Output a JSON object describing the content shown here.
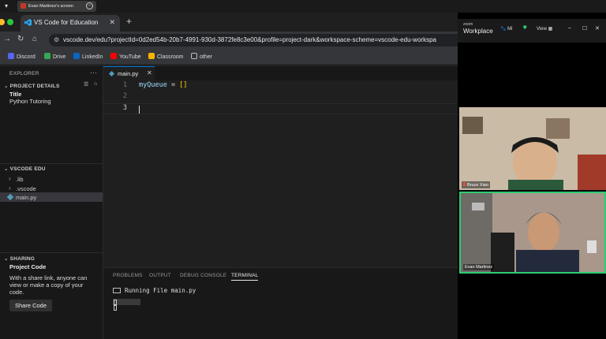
{
  "share_bar": {
    "tab_title": "Evan Martinez's screen"
  },
  "browser": {
    "tab_title": "VS Code for Education",
    "new_tab": "+",
    "url": "vscode.dev/edu?projectId=0d2ed54b-20b7-4991-930d-3872fe8c3e00&profile=project-dark&workspace-scheme=vscode-edu-workspa",
    "bookmarks": [
      {
        "label": "Discord",
        "color": "#5865f2"
      },
      {
        "label": "Drive",
        "color": "#34a853"
      },
      {
        "label": "LinkedIn",
        "color": "#0a66c2"
      },
      {
        "label": "YouTube",
        "color": "#ff0000"
      },
      {
        "label": "Classroom",
        "color": "#f4b400"
      },
      {
        "label": "other",
        "color": "#888888"
      }
    ]
  },
  "explorer": {
    "header": "EXPLORER",
    "project_details": {
      "heading": "PROJECT DETAILS",
      "title_label": "Title",
      "title_value": "Python Tutoring"
    },
    "workspace": {
      "heading": "VSCODE EDU",
      "items": [
        {
          "label": ".lib",
          "type": "folder"
        },
        {
          "label": ".vscode",
          "type": "folder"
        },
        {
          "label": "main.py",
          "type": "file"
        }
      ]
    },
    "sharing": {
      "heading": "SHARING",
      "subheading": "Project Code",
      "description_lines": [
        "With a share link, anyone can",
        "view or make a copy of your",
        "code."
      ],
      "button": "Share Code"
    }
  },
  "editor": {
    "tab": "main.py",
    "lines": [
      {
        "num": "1",
        "var": "myQueue",
        "op": " = ",
        "bracket": "[]"
      },
      {
        "num": "2"
      },
      {
        "num": "3"
      }
    ]
  },
  "panel": {
    "tabs": [
      "PROBLEMS",
      "OUTPUT",
      "DEBUG CONSOLE",
      "TERMINAL"
    ],
    "active_tab": "TERMINAL",
    "terminal_line": "Running File main.py"
  },
  "zoom": {
    "brand_small": "zoom",
    "brand": "Workplace",
    "mute_label": "Mi",
    "view_label": "View",
    "participants": [
      {
        "name": "Bruce Xiao",
        "muted": true
      },
      {
        "name": "Evan Martinez",
        "speaking": true
      }
    ]
  },
  "colors": {
    "accent": "#0078d4",
    "speaking_border": "#2ecc71",
    "python_icon": "#519aba"
  }
}
